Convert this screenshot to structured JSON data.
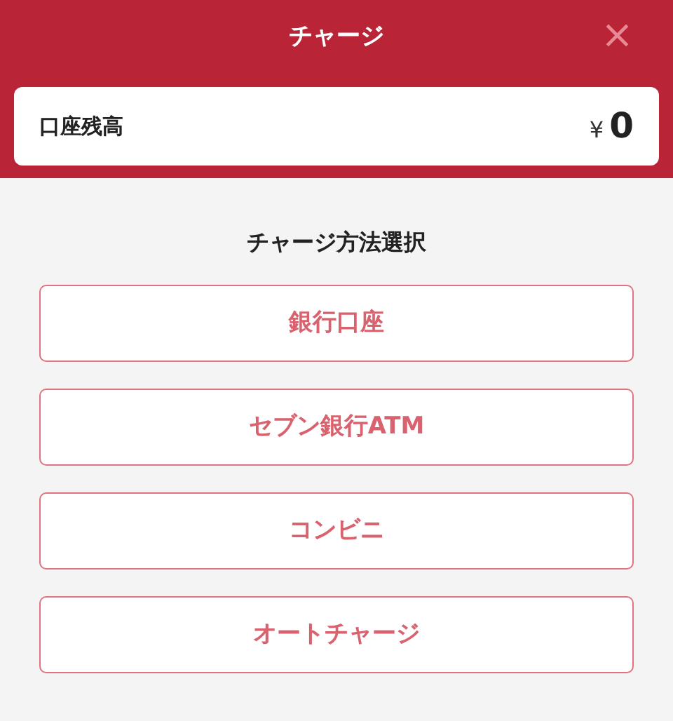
{
  "header": {
    "title": "チャージ",
    "close": "×"
  },
  "balance": {
    "label": "口座残高",
    "currency": "¥",
    "amount": "0"
  },
  "section_title": "チャージ方法選択",
  "methods": [
    "銀行口座",
    "セブン銀行ATM",
    "コンビニ",
    "オートチャージ"
  ]
}
